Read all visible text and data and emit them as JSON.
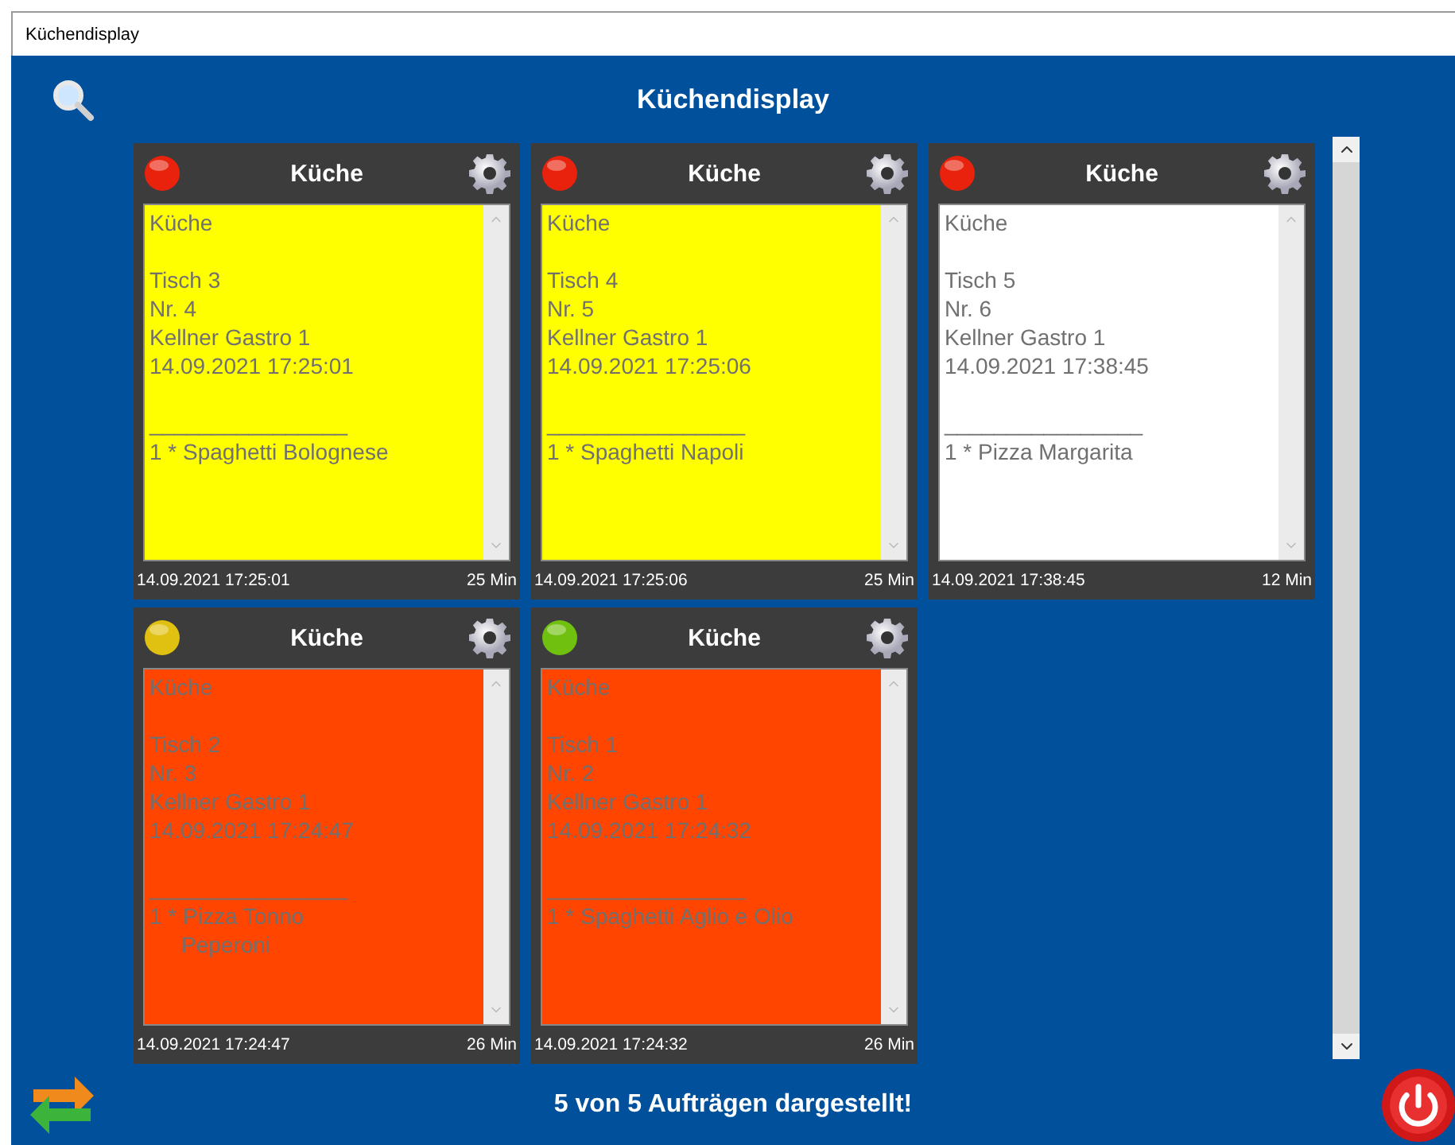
{
  "window": {
    "title": "Küchendisplay"
  },
  "heading": "Küchendisplay",
  "orders": [
    {
      "station": "Küche",
      "color": "#e8220c",
      "ticket": {
        "color": "#ffff00"
      },
      "lines": [
        "Küche",
        "Tisch 3",
        "Nr. 4",
        "Kellner Gastro 1",
        "14.09.2021 17:25:01"
      ],
      "separator": "________________",
      "items": [
        {
          "lines": [
            "1 * Spaghetti Bolognese"
          ]
        }
      ],
      "timestamp": "14.09.2021 17:25:01",
      "elapsed": "25 Min"
    },
    {
      "station": "Küche",
      "color": "#e8220c",
      "ticket": {
        "color": "#ffff00"
      },
      "lines": [
        "Küche",
        "Tisch 4",
        "Nr. 5",
        "Kellner Gastro 1",
        "14.09.2021 17:25:06"
      ],
      "separator": "________________",
      "items": [
        {
          "lines": [
            "1 * Spaghetti Napoli"
          ]
        }
      ],
      "timestamp": "14.09.2021 17:25:06",
      "elapsed": "25 Min"
    },
    {
      "station": "Küche",
      "color": "#e8220c",
      "ticket": {
        "color": "#ffffff"
      },
      "lines": [
        "Küche",
        "Tisch 5",
        "Nr. 6",
        "Kellner Gastro 1",
        "14.09.2021 17:38:45"
      ],
      "separator": "________________",
      "items": [
        {
          "lines": [
            "1 * Pizza  Margarita"
          ]
        }
      ],
      "timestamp": "14.09.2021 17:38:45",
      "elapsed": "12 Min"
    },
    {
      "station": "Küche",
      "color": "#e0c010",
      "ticket": {
        "color": "#ff4500"
      },
      "lines": [
        "Küche",
        "Tisch 2",
        "Nr. 3",
        "Kellner Gastro 1",
        "14.09.2021 17:24:47"
      ],
      "separator": "________________",
      "items": [
        {
          "lines": [
            "1 * Pizza Tonno",
            "Peperoni"
          ]
        }
      ],
      "timestamp": "14.09.2021 17:24:47",
      "elapsed": "26 Min"
    },
    {
      "station": "Küche",
      "color": "#70c010",
      "ticket": {
        "color": "#ff4500"
      },
      "lines": [
        "Küche",
        "Tisch 1",
        "Nr. 2",
        "Kellner Gastro 1",
        "14.09.2021 17:24:32"
      ],
      "separator": "________________",
      "items": [
        {
          "lines": [
            "1 * Spaghetti Aglio e Olio"
          ]
        }
      ],
      "timestamp": "14.09.2021 17:24:32",
      "elapsed": "26 Min"
    }
  ],
  "status": "5 von 5  Aufträgen dargestellt!"
}
